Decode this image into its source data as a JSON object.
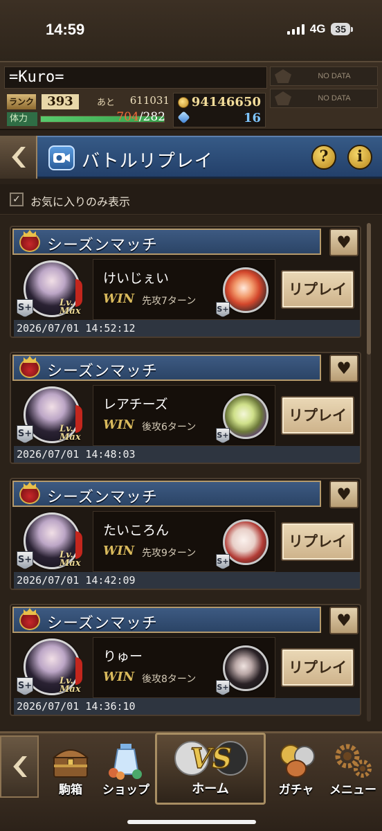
{
  "status_bar": {
    "time": "14:59",
    "network": "4G",
    "battery": "35"
  },
  "player": {
    "name": "=Kuro=",
    "rank_label": "ランク",
    "rank": "393",
    "next_label": "あと",
    "next_exp": "611031",
    "stamina_label": "体力",
    "stamina_current": "704",
    "stamina_max": "/282",
    "coins": "94146650",
    "gems": "16",
    "nodata": [
      "NO DATA",
      "NO DATA"
    ]
  },
  "header": {
    "title": "バトルリプレイ",
    "help_icon": "?",
    "info_icon": "i"
  },
  "filter": {
    "label": "お気に入りのみ表示",
    "checked": true
  },
  "colors": {
    "win": "#d8b95c",
    "header_blue": "#2b4466",
    "stamina_current": "#f26a3a"
  },
  "matches": [
    {
      "title": "シーズンマッチ",
      "opponent": "けいじぇい",
      "result": "WIN",
      "turn": "先攻7ターン",
      "replay_label": "リプレイ",
      "date": "2026/07/01 14:52:12",
      "player_badge": "S+",
      "opp_badge": "S+",
      "lv_label": "Lv.\nMax"
    },
    {
      "title": "シーズンマッチ",
      "opponent": "レアチーズ",
      "result": "WIN",
      "turn": "後攻6ターン",
      "replay_label": "リプレイ",
      "date": "2026/07/01 14:48:03",
      "player_badge": "S+",
      "opp_badge": "S+",
      "lv_label": "Lv.\nMax"
    },
    {
      "title": "シーズンマッチ",
      "opponent": "たいころん",
      "result": "WIN",
      "turn": "先攻9ターン",
      "replay_label": "リプレイ",
      "date": "2026/07/01 14:42:09",
      "player_badge": "S+",
      "opp_badge": "S+",
      "lv_label": "Lv.\nMax"
    },
    {
      "title": "シーズンマッチ",
      "opponent": "りゅー",
      "result": "WIN",
      "turn": "後攻8ターン",
      "replay_label": "リプレイ",
      "date": "2026/07/01 14:36:10",
      "player_badge": "S+",
      "opp_badge": "S+",
      "lv_label": "Lv.\nMax"
    }
  ],
  "nav": {
    "items": [
      {
        "label": "駒箱",
        "icon": "chest-icon"
      },
      {
        "label": "ショップ",
        "icon": "shop-potion-icon"
      },
      {
        "label": "ホーム",
        "icon": "vs-icon"
      },
      {
        "label": "ガチャ",
        "icon": "coins-icon"
      },
      {
        "label": "メニュー",
        "icon": "gear-icon"
      }
    ],
    "vs_text": "VS"
  }
}
